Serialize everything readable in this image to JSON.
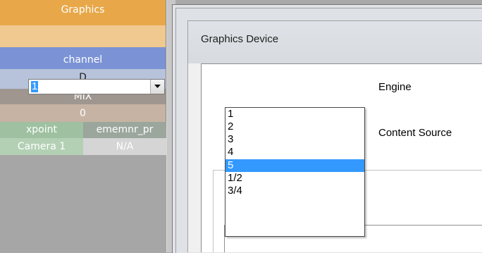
{
  "left_panel": {
    "title": "Graphics",
    "channel_label": "channel",
    "channel_value": "D",
    "mix_label": "MIX",
    "mix_value": "0",
    "xpoint_label": "xpoint",
    "xpoint_value": "ememnr_pr",
    "camera_label": "Camera 1",
    "camera_value": "N/A"
  },
  "dialog": {
    "title": "Graphics Device",
    "engine_label": "Engine",
    "engine_selected": "1",
    "content_source_label": "Content Source",
    "dropdown_icon": "chevron-down-icon"
  },
  "engine_options": [
    "1",
    "2",
    "3",
    "4",
    "5",
    "1/2",
    "3/4"
  ],
  "engine_highlighted_index": 4,
  "colors": {
    "selection": "#3399ff",
    "graphics_header": "#e8a84a",
    "channel_header": "#7b93d4"
  }
}
